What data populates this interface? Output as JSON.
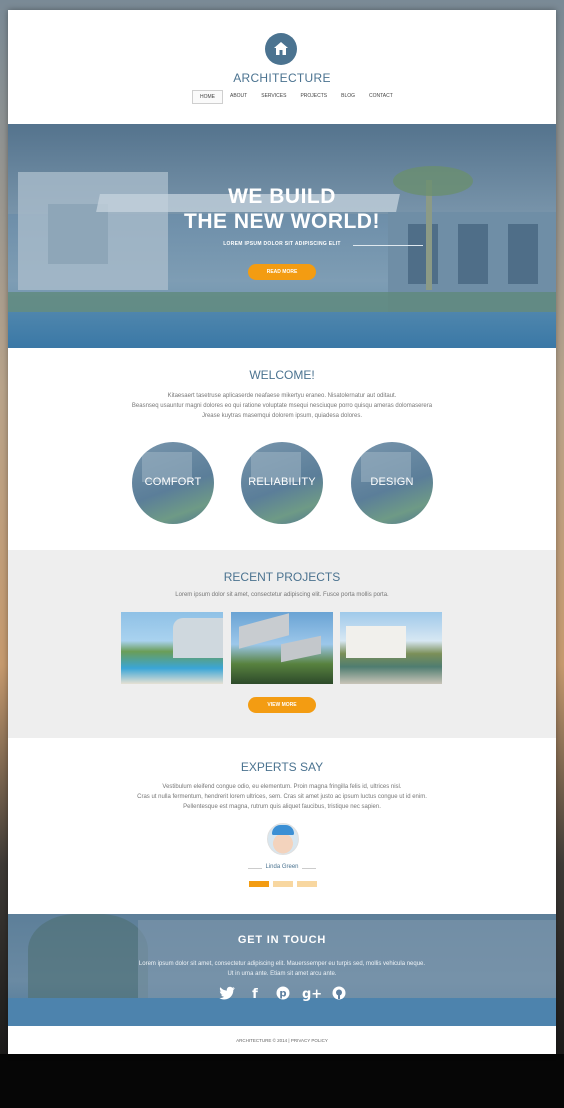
{
  "brand": {
    "name": "ARCHITECTURE",
    "logo_icon": "home-icon"
  },
  "nav": [
    {
      "label": "HOME",
      "active": true
    },
    {
      "label": "ABOUT"
    },
    {
      "label": "SERVICES"
    },
    {
      "label": "PROJECTS"
    },
    {
      "label": "BLOG"
    },
    {
      "label": "CONTACT"
    }
  ],
  "hero": {
    "title_line1": "WE BUILD",
    "title_line2": "THE NEW WORLD!",
    "subtitle": "LOREM IPSUM DOLOR SIT ADIPISCING ELIT",
    "button": "READ MORE"
  },
  "welcome": {
    "title": "WELCOME!",
    "lines": [
      "Kitaesaert tasetruse aplicaserde neafaese mikertyu eraneo. Nisatolernatur aut oditaut.",
      "Beasnseq usauntur magni dolores eo qui ratione voluptate msequi nesciuque porro quisqu ameras dolomaserera",
      "Jrease kuytras masemqui dolorem ipsum, quiadesa dolores."
    ],
    "features": [
      "COMFORT",
      "RELIABILITY",
      "DESIGN"
    ]
  },
  "projects": {
    "title": "RECENT PROJECTS",
    "subtitle": "Lorem ipsum dolor sit amet, consectetur adipiscing elit. Fusce porta mollis porta.",
    "button": "VIEW MORE"
  },
  "experts": {
    "title": "EXPERTS SAY",
    "lines": [
      "Vestibulum eleifend congue odio, eu elementum. Proin magna fringilla felis id, ultrices nisl.",
      "Cras ut nulla fermentum, hendrerit lorem ultrices, sem. Cras sit amet justo ac ipsum luctus congue ut id enim.",
      "Pellentesque est magna, rutrum quis aliquet faucibus, tristique nec sapien."
    ],
    "name": "Linda Green"
  },
  "contact": {
    "title": "GET IN  TOUCH",
    "lines": [
      "Lorem ipsum dolor sit amet, consectetur adipiscing elit. Mauerssemper eu turpis sed, mollis vehicula neque.",
      "Ut in urna ante. Etiam sit amet arcu ante."
    ],
    "social": [
      {
        "icon": "twitter-icon",
        "glyph": "t"
      },
      {
        "icon": "facebook-icon",
        "glyph": "f"
      },
      {
        "icon": "pinterest-icon",
        "glyph": "p"
      },
      {
        "icon": "google-plus-icon",
        "glyph": "g+"
      },
      {
        "icon": "github-icon",
        "glyph": "◉"
      }
    ]
  },
  "footer": {
    "copyright": "ARCHITECTURE © 2014  |  PRIVACY POLICY"
  },
  "colors": {
    "accent": "#f39c12",
    "brand": "#4b7390"
  }
}
